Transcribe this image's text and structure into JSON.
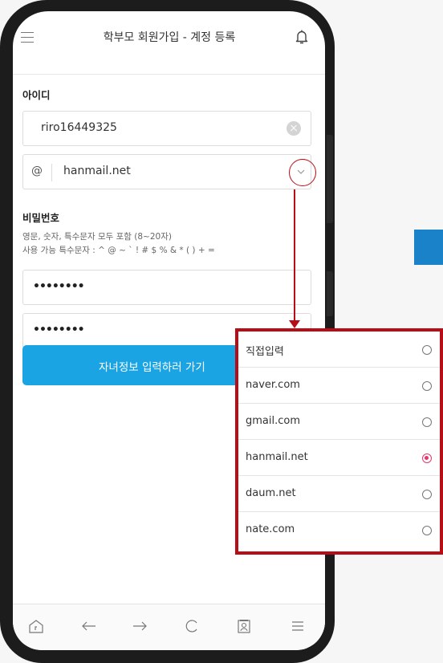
{
  "header": {
    "title": "학부모 회원가입 - 계정 등록",
    "menu_icon": "hamburger-menu-icon",
    "bell_icon": "bell-icon"
  },
  "id_section": {
    "label": "아이디",
    "username_value": "riro16449325",
    "at_symbol": "@",
    "domain_value": "hanmail.net"
  },
  "password_section": {
    "label": "비밀번호",
    "hint_line1": "영문, 숫자, 특수문자 모두 포함 (8~20자)",
    "hint_line2": "사용 가능 특수문자 : ^ @ ~ ` ! # $ % & * ( ) + =",
    "password_value": "••••••••",
    "confirm_value": "••••••••"
  },
  "submit_label": "자녀정보 입력하러 가기",
  "bottom_nav": [
    "home-icon",
    "back-arrow-icon",
    "forward-arrow-icon",
    "refresh-icon",
    "contact-card-icon",
    "menu-icon"
  ],
  "domain_dropdown": {
    "options": [
      {
        "label": "직접입력",
        "selected": false
      },
      {
        "label": "naver.com",
        "selected": false
      },
      {
        "label": "gmail.com",
        "selected": false
      },
      {
        "label": "hanmail.net",
        "selected": true
      },
      {
        "label": "daum.net",
        "selected": false
      },
      {
        "label": "nate.com",
        "selected": false
      }
    ]
  },
  "colors": {
    "accent": "#1aa4e4",
    "highlight": "#b70d17",
    "radio_selected": "#e8366a"
  }
}
